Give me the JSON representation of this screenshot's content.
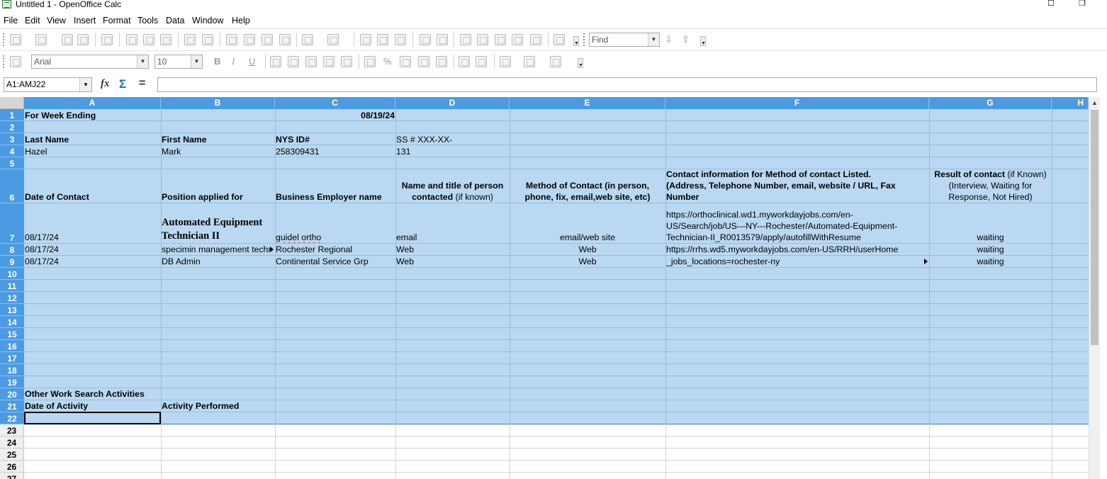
{
  "window": {
    "title": "Untitled 1 - OpenOffice Calc",
    "restore_glyph": "❐",
    "max_glyph": "☐"
  },
  "menu": [
    "File",
    "Edit",
    "View",
    "Insert",
    "Format",
    "Tools",
    "Data",
    "Window",
    "Help"
  ],
  "toolbar": {
    "find_placeholder": "Find"
  },
  "format_toolbar": {
    "font_name": "Arial",
    "font_size": "10",
    "bold": "B",
    "italic": "I",
    "underline": "U"
  },
  "formula_bar": {
    "name_box": "A1:AMJ22",
    "fx": "fx",
    "sum": "Σ",
    "equals": "=",
    "content": ""
  },
  "columns": [
    "A",
    "B",
    "C",
    "D",
    "E",
    "F",
    "G",
    "H"
  ],
  "rows": [
    "1",
    "2",
    "3",
    "4",
    "5",
    "6",
    "7",
    "8",
    "9",
    "10",
    "11",
    "12",
    "13",
    "14",
    "15",
    "16",
    "17",
    "18",
    "19",
    "20",
    "21",
    "22",
    "23",
    "24",
    "25",
    "26",
    "27"
  ],
  "cells": {
    "a1": "For Week Ending",
    "c1": "08/19/24",
    "a3": "Last Name",
    "b3": "First Name",
    "c3": "NYS ID#",
    "d3": "SS # XXX-XX-",
    "a4": "Hazel",
    "b4": "Mark",
    "c4": "258309431",
    "d4": "131",
    "a6": "Date of Contact",
    "b6": "Position applied for",
    "c6": "Business Employer name",
    "d6_bold": "Name and title of person",
    "d6_bold2": "contacted",
    "d6_normal": "(if known)",
    "e6_line1": "Method of Contact (in person,",
    "e6_line2": "phone, fix, email,web site, etc)",
    "f6_line1": "Contact information for Method of contact Listed.",
    "f6_line2": "(Address, Telephone Number, email, website / URL, Fax",
    "f6_line3": "Number",
    "g6_bold": "Result of contact",
    "g6_normal1": "(if Known)",
    "g6_normal2": "(Interview, Waiting for",
    "g6_normal3": "Response, Not Hired)",
    "a7": "08/17/24",
    "b7_line1": "Automated Equipment",
    "b7_line2": "Technician II",
    "c7": "guidel ortho",
    "d7": "email",
    "e7": "email/web site",
    "f7_line1": "https://orthoclinical.wd1.myworkdayjobs.com/en-",
    "f7_line2": "US/Search/job/US---NY---Rochester/Automated-Equipment-",
    "f7_line3": "Technician-II_R0013579/apply/autofillWithResume",
    "g7": "waiting",
    "a8": "08/17/24",
    "b8": "specimin management technician",
    "c8": "Rochester Regional",
    "d8": "Web",
    "e8": "Web",
    "f8": "https://rrhs.wd5.myworkdayjobs.com/en-US/RRH/userHome",
    "g8": "waiting",
    "a9": "08/17/24",
    "b9": "DB Admin",
    "c9": "Continental Service Grp",
    "d9": "Web",
    "e9": "Web",
    "f9": "_jobs_locations=rochester-ny",
    "g9": "waiting",
    "a20": "Other Work Search Activities",
    "a21": "Date of Activity",
    "b21": "Activity Performed"
  }
}
